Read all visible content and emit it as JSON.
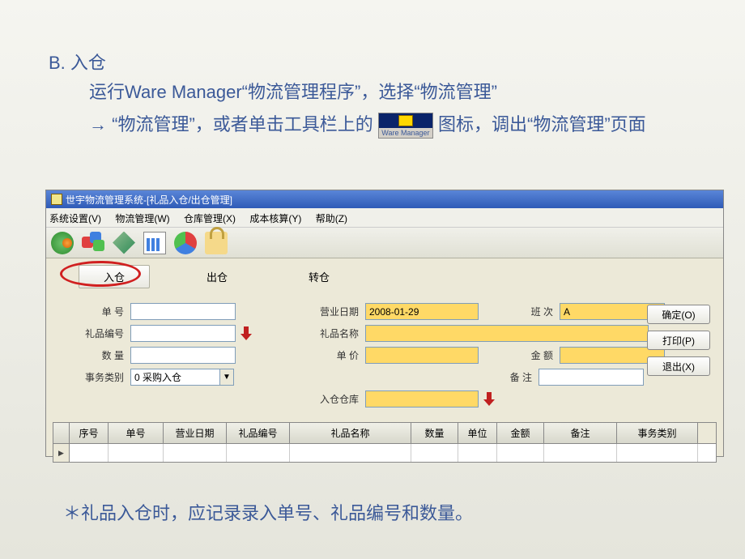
{
  "slide": {
    "heading": "B. 入仓",
    "line1_prefix": "运行Ware Manager“物流管理程序”，选择“物流管理”",
    "line2_prefix": "→ “物流管理”，或者单击工具栏上的",
    "line2_suffix": " 图标，调出“物流管理”页面",
    "icon_label": "Ware Manager",
    "footer": "＊礼品入仓时，应记录录入单号、礼品编号和数量。"
  },
  "window": {
    "title": "世宇物流管理系统-[礼品入仓/出仓管理]"
  },
  "menu": {
    "m1": "系统设置(V)",
    "m2": "物流管理(W)",
    "m3": "仓库管理(X)",
    "m4": "成本核算(Y)",
    "m5": "帮助(Z)"
  },
  "tabs": {
    "in": "入仓",
    "out": "出仓",
    "transfer": "转仓"
  },
  "form": {
    "order_no_label": "单   号",
    "biz_date_label": "营业日期",
    "biz_date": "2008-01-29",
    "shift_label": "班   次",
    "shift": "A",
    "gift_code_label": "礼品编号",
    "gift_name_label": "礼品名称",
    "qty_label": "数   量",
    "price_label": "单   价",
    "amount_label": "金   额",
    "trans_type_label": "事务类别",
    "trans_type": "0 采购入仓",
    "remark_label": "备   注",
    "warehouse_label": "入仓仓库"
  },
  "buttons": {
    "ok": "确定(O)",
    "print": "打印(P)",
    "exit": "退出(X)"
  },
  "table": {
    "seq": "序号",
    "order": "单号",
    "date": "营业日期",
    "code": "礼品编号",
    "name": "礼品名称",
    "qty": "数量",
    "unit": "单位",
    "amt": "金额",
    "remark": "备注",
    "type": "事务类别"
  }
}
